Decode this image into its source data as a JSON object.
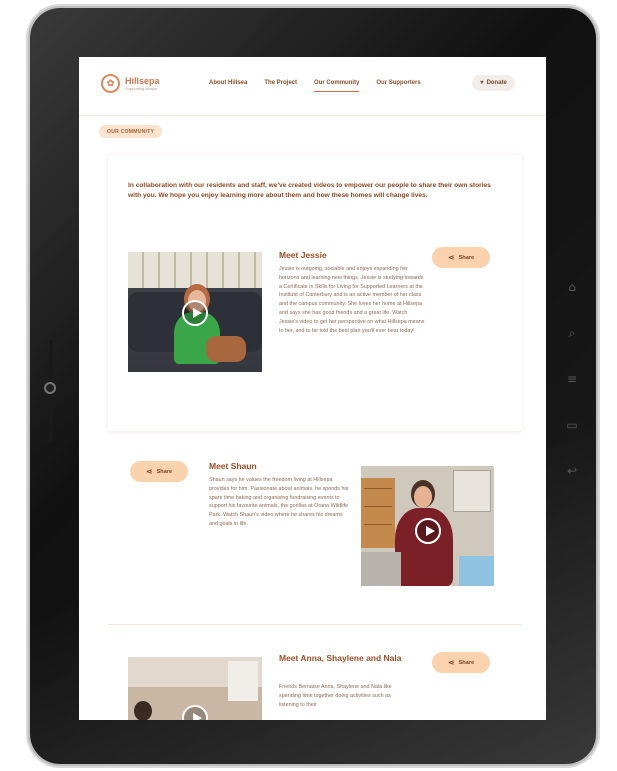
{
  "nav": {
    "logo_name": "Hillsepa",
    "logo_sub": "Supporting people",
    "links": [
      "About Hillsea",
      "The Project",
      "Our Community",
      "Our Supporters"
    ],
    "donate_label": "Donate"
  },
  "section_pill": "OUR COMMUNITY",
  "intro": "In collaboration with our residents and staff, we've created videos to empower our people to share their own stories with you. We hope you enjoy learning more about them and how these homes will change lives.",
  "members": [
    {
      "title": "Meet Jessie",
      "bio": "Jessie is outgoing, sociable and enjoys expanding her horizons and learning new things. Jessie is studying towards a Certificate in Skills for Living for Supported Learners at the Institute of Canterbury and is an active member of her class and the campus community. She loves her home at Hillsepa and says she has good friends and a great life. Watch Jessie's video to get her perspective on what Hillsepa means to her, and to be told the best plan you'll ever hear today!",
      "share_label": "Share"
    },
    {
      "title": "Meet Shaun",
      "bio": "Shaun says he values the freedom living at Hillsepa provides for him. Passionate about animals, he spends his spare time baking and organising fundraising events to support his favourite animals, the gorillas at Orana Wildlife Park. Watch Shaun's video where he shares his dreams and goals in life.",
      "share_label": "Share"
    },
    {
      "title": "Meet Anna, Shaylene and Nala",
      "bio": "Friends Bernaise Anna, Shaylene and Nala like spending time together doing activities such as listening to their",
      "share_label": "Share"
    }
  ],
  "icons": {
    "play": "play-icon",
    "share": "share-icon",
    "donate": "heart-icon"
  },
  "colors": {
    "accent": "#9b4f25",
    "pill_bg": "#fbe3cd",
    "share_bg": "#fbd2ae"
  }
}
